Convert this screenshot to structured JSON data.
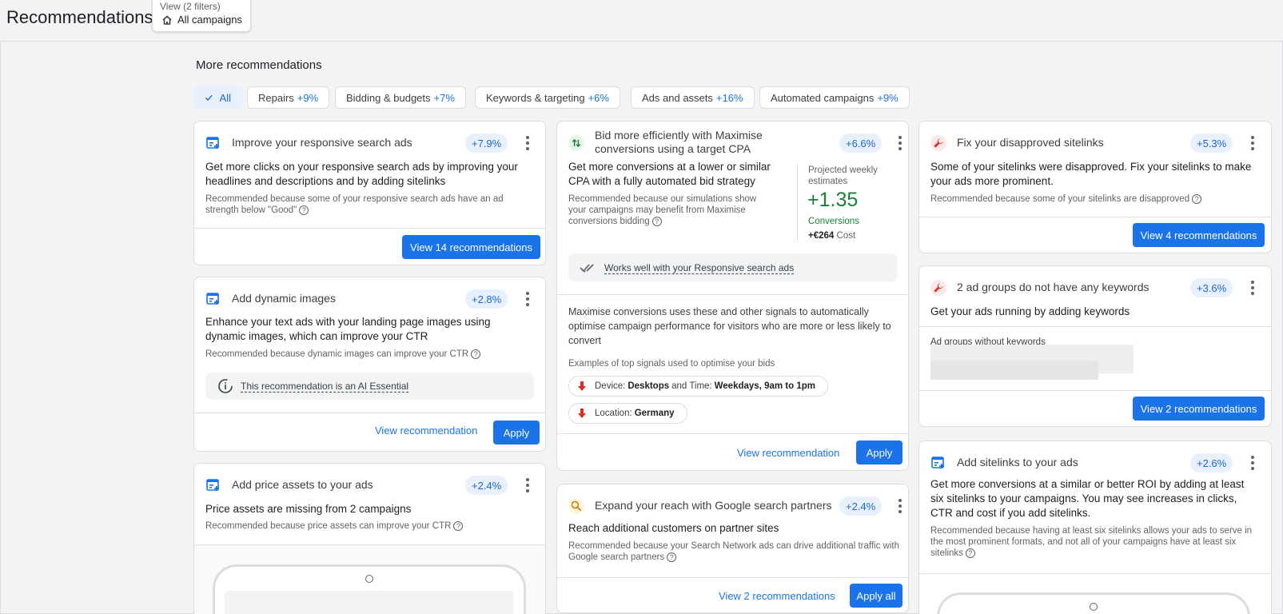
{
  "header": {
    "title": "Recommendations",
    "view_label": "View (2 filters)",
    "view_value": "All campaigns"
  },
  "section_title": "More recommendations",
  "filters": [
    {
      "label": "All",
      "pct": ""
    },
    {
      "label": "Repairs",
      "pct": "+9%"
    },
    {
      "label": "Bidding & budgets",
      "pct": "+7%"
    },
    {
      "label": "Keywords & targeting",
      "pct": "+6%"
    },
    {
      "label": "Ads and assets",
      "pct": "+16%"
    },
    {
      "label": "Automated campaigns",
      "pct": "+9%"
    }
  ],
  "cards": {
    "rsa": {
      "title": "Improve your responsive search ads",
      "badge": "+7.9%",
      "main": "Get more clicks on your responsive search ads by improving your headlines and descriptions and by adding sitelinks",
      "reason": "Recommended because some of your responsive search ads have an ad strength below \"Good\"",
      "button": "View 14 recommendations"
    },
    "dynamic": {
      "title": "Add dynamic images",
      "badge": "+2.8%",
      "main": "Enhance your text ads with your landing page images using dynamic images, which can improve your CTR",
      "reason": "Recommended because dynamic images can improve your CTR",
      "ai_note": "This recommendation is an AI Essential",
      "link": "View recommendation",
      "button": "Apply"
    },
    "price": {
      "title": "Add price assets to your ads",
      "badge": "+2.4%",
      "main": "Price assets are missing from 2 campaigns",
      "reason": "Recommended because price assets can improve your CTR"
    },
    "bid": {
      "title": "Bid more efficiently with Maximise conversions using a target CPA",
      "badge": "+6.6%",
      "main": "Get more conversions at a lower or similar CPA with a fully automated bid strategy",
      "reason": "Recommended because our simulations show your campaigns may benefit from Maximise conversions bidding",
      "projected_label": "Projected weekly estimates",
      "projected_value": "+1.35",
      "projected_metric": "Conversions",
      "cost_value": "+€264",
      "cost_label": "Cost",
      "works_well": "Works well with your Responsive search ads",
      "signals_text": "Maximise conversions uses these and other signals to automatically optimise campaign performance for visitors who are more or less likely to convert",
      "signals_caption": "Examples of top signals used to optimise your bids",
      "signal1": {
        "pre": "Device:",
        "v1": "Desktops",
        "mid": "and Time:",
        "v2": "Weekdays, 9am to 1pm"
      },
      "signal2": {
        "pre": "Location:",
        "v1": "Germany"
      },
      "link": "View recommendation",
      "button": "Apply"
    },
    "partners": {
      "title": "Expand your reach with Google search partners",
      "badge": "+2.4%",
      "main": "Reach additional customers on partner sites",
      "reason": "Recommended because your Search Network ads can drive additional traffic with Google search partners",
      "link": "View 2 recommendations",
      "button": "Apply all"
    },
    "sitelinks_fix": {
      "title": "Fix your disapproved sitelinks",
      "badge": "+5.3%",
      "main": "Some of your sitelinks were disapproved. Fix your sitelinks to make your ads more prominent.",
      "reason": "Recommended because some of your sitelinks are disapproved",
      "button": "View 4 recommendations"
    },
    "keywords": {
      "title": "2 ad groups do not have any keywords",
      "badge": "+3.6%",
      "main": "Get your ads running by adding keywords",
      "list_label": "Ad groups without keywords",
      "button": "View 2 recommendations"
    },
    "sitelinks_add": {
      "title": "Add sitelinks to your ads",
      "badge": "+2.6%",
      "main": "Get more conversions at a similar or better ROI by adding at least six sitelinks to your campaigns. You may see increases in clicks, CTR and cost if you add sitelinks.",
      "reason": "Recommended because having at least six sitelinks allows your ads to serve in the most prominent formats, and not all of your campaigns have at least six sitelinks"
    }
  },
  "colors": {
    "primary": "#1a73e8",
    "badge_bg": "#e8f0fe",
    "positive": "#188038",
    "repair_icon": "#d93025",
    "search_icon": "#e37400"
  }
}
